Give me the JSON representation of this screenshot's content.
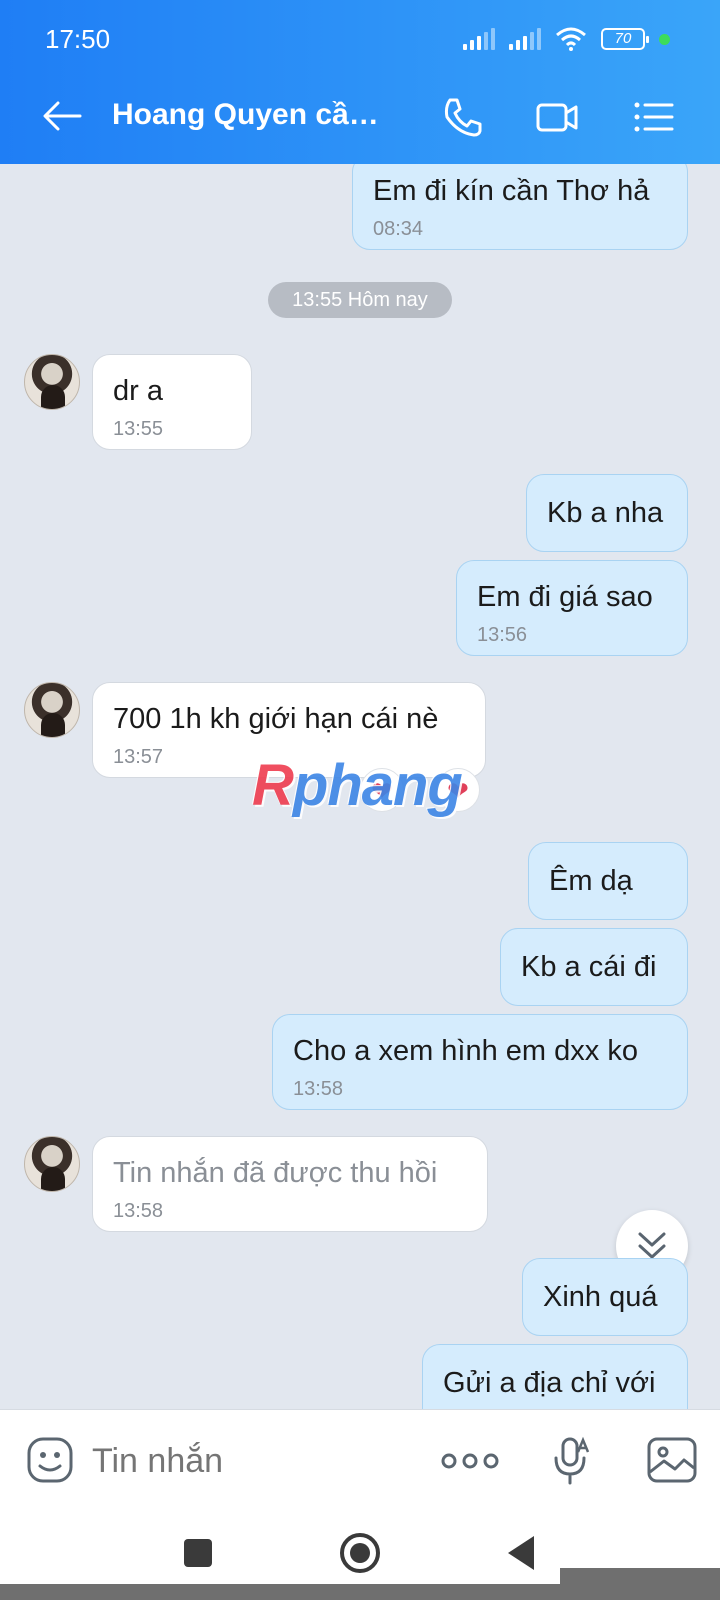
{
  "status_bar": {
    "time": "17:50",
    "battery": "70"
  },
  "header": {
    "title": "Hoang Quyen cần…"
  },
  "date_separator": "13:55 Hôm nay",
  "messages": [
    {
      "dir": "out",
      "text": "Em đi kín cần Thơ hả",
      "time": "08:34"
    },
    {
      "dir": "in",
      "text": "dr a",
      "time": "13:55"
    },
    {
      "dir": "out",
      "text": "Kb a nha",
      "time": ""
    },
    {
      "dir": "out",
      "text": "Em đi giá sao",
      "time": "13:56"
    },
    {
      "dir": "in",
      "text": "700 1h kh giới hạn cái nè",
      "time": "13:57"
    },
    {
      "dir": "out",
      "text": "Êm dạ",
      "time": ""
    },
    {
      "dir": "out",
      "text": "Kb a cái đi",
      "time": ""
    },
    {
      "dir": "out",
      "text": "Cho a xem hình em dxx ko",
      "time": "13:58"
    },
    {
      "dir": "in",
      "text": "Tin nhắn đã được thu hồi",
      "time": "13:58"
    },
    {
      "dir": "out",
      "text": "Xinh quá",
      "time": ""
    },
    {
      "dir": "out",
      "text": "Gửi a địa chỉ với",
      "time": ""
    }
  ],
  "reactions": [
    "❤",
    "❤"
  ],
  "watermark": {
    "first": "R",
    "rest": "phang"
  },
  "composer": {
    "placeholder": "Tin nhắn"
  },
  "colors": {
    "header_start": "#1f7ef5",
    "header_end": "#3aa5f9",
    "outgoing_bubble": "#d5ecfd",
    "chat_background": "#e2e7ef"
  }
}
